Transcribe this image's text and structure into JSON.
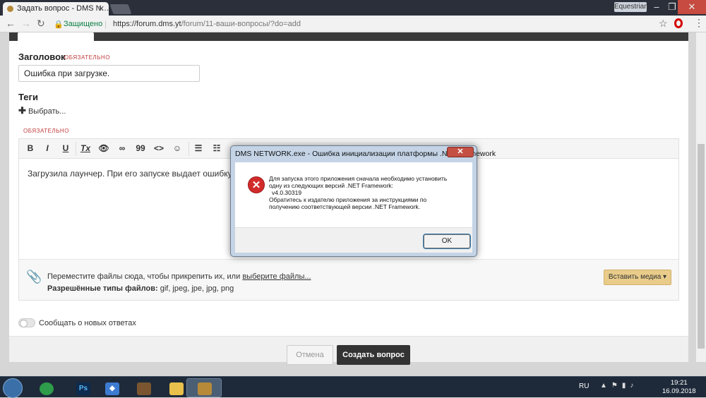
{
  "browser": {
    "tab_title": "Задать вопрос - DMS N…",
    "profile": "Equestrian",
    "secure_label": "Защищено",
    "url_host": "https://forum.dms.yt",
    "url_path": "/forum/11-ваши-вопросы/?do=add"
  },
  "form": {
    "title_label": "Заголовок",
    "required_label": "ОБЯЗАТЕЛЬНО",
    "title_value": "Ошибка при загрузке.",
    "tags_label": "Теги",
    "tags_choose": "Выбрать...",
    "required_label_2": "ОБЯЗАТЕЛЬНО",
    "editor_text": "Загрузила лаунчер. При его запуске выдает ошибку. Скрин н",
    "attach_line1_prefix": "Переместите файлы сюда, чтобы прикрепить их, или ",
    "attach_line1_link": "выберите файлы...",
    "attach_line2_label": "Разрешённые типы файлов:",
    "attach_line2_types": " gif, jpeg, jpe, jpg, png",
    "insert_media": "Вставить медиа ▾",
    "notify_label": "Сообщать о новых ответах",
    "cancel_label": "Отмена",
    "submit_label": "Создать вопрос"
  },
  "toolbar": [
    "B",
    "I",
    "U",
    "Tx",
    "👁",
    "∞",
    "99",
    "<>",
    "☺",
    "☰",
    "☷"
  ],
  "dialog": {
    "title": "DMS NETWORK.exe - Ошибка инициализации платформы .NET Framework",
    "lines": [
      "Для запуска этого приложения сначала необходимо установить",
      "одну из следующих версий .NET Framework:",
      "  v4.0.30319",
      " Обратитесь к издателю приложения за инструкциями по",
      "получению соответствующей версии .NET Framework."
    ],
    "ok_label": "OK"
  },
  "taskbar": {
    "lang": "RU",
    "time": "19:21",
    "date": "16.09.2018"
  }
}
